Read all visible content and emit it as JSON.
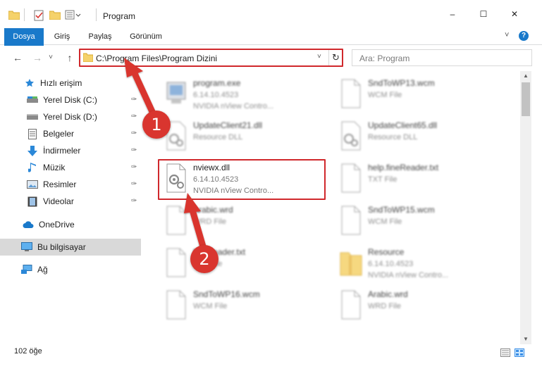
{
  "window": {
    "title": "Program",
    "minimize_label": "–",
    "maximize_label": "☐",
    "close_label": "✕"
  },
  "ribbon": {
    "tabs": [
      "Dosya",
      "Giriş",
      "Paylaş",
      "Görünüm"
    ],
    "expand_icon": "chevron-down-icon",
    "help_label": "?"
  },
  "nav": {
    "back_icon": "←",
    "forward_icon": "→",
    "recent_icon": "˅",
    "up_icon": "↑"
  },
  "address": {
    "path": "C:\\Program Files\\Program Dizini",
    "dropdown": "˅",
    "refresh": "↻"
  },
  "search": {
    "placeholder": "Ara: Program"
  },
  "sidebar": {
    "items": [
      {
        "label": "Hızlı erişim",
        "icon": "star-icon",
        "pinned": false
      },
      {
        "label": "Yerel Disk (C:)",
        "icon": "drive-icon",
        "pinned": true
      },
      {
        "label": "Yerel Disk (D:)",
        "icon": "drive-icon",
        "pinned": true
      },
      {
        "label": "Belgeler",
        "icon": "document-icon",
        "pinned": true
      },
      {
        "label": "İndirmeler",
        "icon": "download-icon",
        "pinned": true
      },
      {
        "label": "Müzik",
        "icon": "music-icon",
        "pinned": true
      },
      {
        "label": "Resimler",
        "icon": "pictures-icon",
        "pinned": true
      },
      {
        "label": "Videolar",
        "icon": "videos-icon",
        "pinned": true
      },
      {
        "label": "OneDrive",
        "icon": "cloud-icon",
        "pinned": false
      },
      {
        "label": "Bu bilgisayar",
        "icon": "computer-icon",
        "pinned": false
      },
      {
        "label": "Ağ",
        "icon": "network-icon",
        "pinned": false
      }
    ],
    "pin_glyph": "📌"
  },
  "files": [
    {
      "name": "program.exe",
      "line1": "6.14.10.4523",
      "line2": "NVIDIA nView Contro...",
      "icon": "exe-icon",
      "blurred": true
    },
    {
      "name": "SndToWP13.wcm",
      "line1": "WCM File",
      "line2": "",
      "icon": "blank-file-icon",
      "blurred": true
    },
    {
      "name": "UpdateClient21.dll",
      "line1": "Resource DLL",
      "line2": "",
      "icon": "dll-icon",
      "blurred": true
    },
    {
      "name": "UpdateClient65.dll",
      "line1": "Resource DLL",
      "line2": "",
      "icon": "dll-icon",
      "blurred": true
    },
    {
      "name": "nviewx.dll",
      "line1": "6.14.10.4523",
      "line2": "NVIDIA nView Contro...",
      "icon": "dll-icon",
      "blurred": false
    },
    {
      "name": "help.fineReader.txt",
      "line1": "TXT File",
      "line2": "",
      "icon": "blank-file-icon",
      "blurred": true
    },
    {
      "name": "Arabic.wrd",
      "line1": "WRD File",
      "line2": "",
      "icon": "blank-file-icon",
      "blurred": true
    },
    {
      "name": "SndToWP15.wcm",
      "line1": "WCM File",
      "line2": "",
      "icon": "blank-file-icon",
      "blurred": true
    },
    {
      "name": "fineReader.txt",
      "line1": "TXT File",
      "line2": "",
      "icon": "blank-file-icon",
      "blurred": true
    },
    {
      "name": "Resource",
      "line1": "6.14.10.4523",
      "line2": "NVIDIA nView Contro...",
      "icon": "folder-zip-icon",
      "blurred": true
    },
    {
      "name": "SndToWP16.wcm",
      "line1": "WCM File",
      "line2": "",
      "icon": "blank-file-icon",
      "blurred": true
    },
    {
      "name": "Arabic.wrd",
      "line1": "WRD File",
      "line2": "",
      "icon": "blank-file-icon",
      "blurred": true
    }
  ],
  "status": {
    "item_count": "102 öğe"
  },
  "annotations": {
    "step1": "1",
    "step2": "2"
  },
  "colors": {
    "accent": "#1979ca",
    "highlight_red": "#d0282c",
    "callout_red": "#d9352f"
  }
}
